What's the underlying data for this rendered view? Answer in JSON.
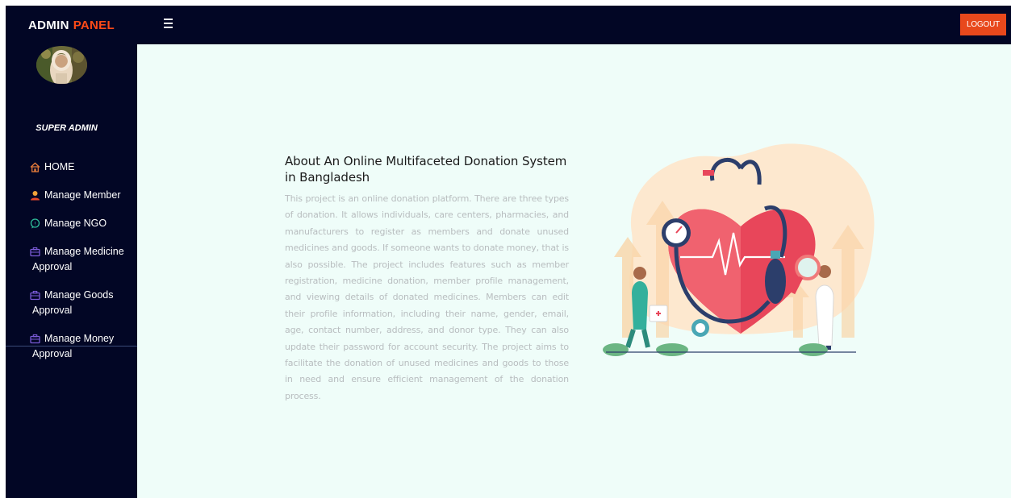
{
  "header": {
    "brand_part1": "ADMIN",
    "brand_part2": "PANEL",
    "menu_icon": "hamburger-icon",
    "logout_label": "LOGOUT"
  },
  "sidebar": {
    "role": "SUPER ADMIN",
    "items": [
      {
        "label": "HOME",
        "icon": "home-icon"
      },
      {
        "label": "Manage Member",
        "icon": "user-icon"
      },
      {
        "label": "Manage NGO",
        "icon": "chat-icon"
      },
      {
        "label": "Manage Medicine Approval",
        "icon": "briefcase-icon"
      },
      {
        "label": "Manage Goods Approval",
        "icon": "briefcase-icon"
      },
      {
        "label": "Manage Money Approval",
        "icon": "briefcase-icon"
      }
    ]
  },
  "main": {
    "title": "About An Online Multifaceted Donation System in Bangladesh",
    "description": "This project is an online donation platform. There are three types of donation. It allows individuals, care centers, pharmacies, and manufacturers to register as members and donate unused medicines and goods. If someone wants to donate money, that is also possible. The project includes features such as member registration, medicine donation, member profile management, and viewing details of donated medicines. Members can edit their profile information, including their name, gender, email, age, contact number, address, and donor type. They can also update their password for account security. The project aims to facilitate the donation of unused medicines and goods to those in need and ensure efficient management of the donation process."
  },
  "colors": {
    "navy": "#020625",
    "accent": "#ff4a17",
    "logout_bg": "#e8481c",
    "content_bg": "#effdf9"
  }
}
